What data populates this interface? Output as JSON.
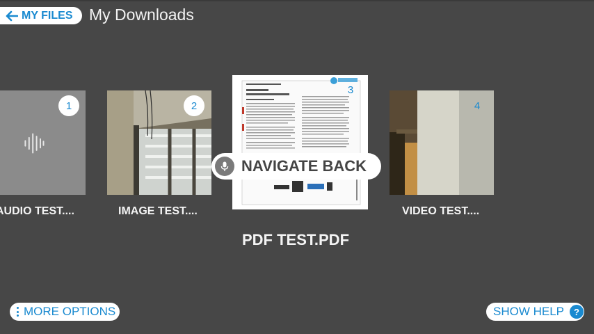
{
  "header": {
    "back_label": "MY FILES",
    "title": "My Downloads"
  },
  "files": [
    {
      "index": "1",
      "name": "AUDIO TEST....",
      "type": "audio"
    },
    {
      "index": "2",
      "name": "IMAGE TEST....",
      "type": "image"
    },
    {
      "index": "3",
      "name": "PDF TEST.PDF",
      "type": "pdf",
      "selected": true
    },
    {
      "index": "4",
      "name": "VIDEO TEST....",
      "type": "video"
    }
  ],
  "voice_prompt": {
    "label": "NAVIGATE BACK",
    "icon": "mic-icon"
  },
  "footer": {
    "more_options_label": "MORE OPTIONS",
    "show_help_label": "SHOW HELP",
    "help_icon": "?"
  },
  "colors": {
    "background": "#474747",
    "accent": "#1a8ad0",
    "pill": "#ffffff"
  }
}
